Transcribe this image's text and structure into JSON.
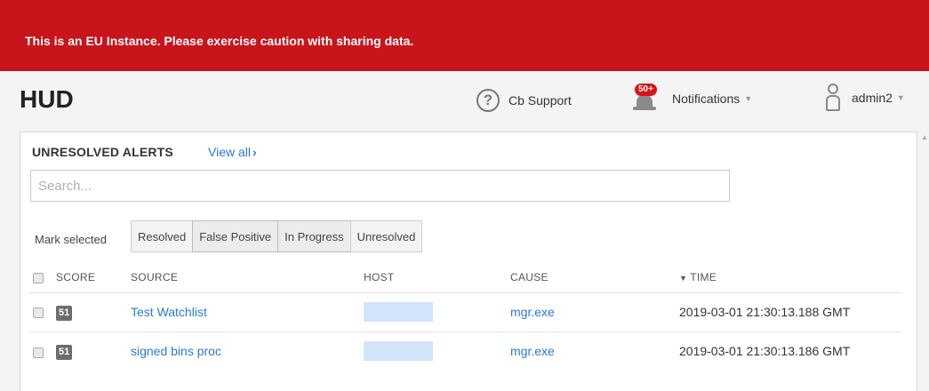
{
  "banner": {
    "text": "This is an EU Instance. Please exercise caution with sharing data."
  },
  "header": {
    "title": "HUD",
    "support_label": "Cb Support",
    "notifications_label": "Notifications",
    "notifications_badge": "50+",
    "user_label": "admin2"
  },
  "alerts": {
    "title": "UNRESOLVED ALERTS",
    "view_all": "View all",
    "search_placeholder": "Search...",
    "mark_selected_label": "Mark selected",
    "mark_buttons": [
      "Resolved",
      "False Positive",
      "In Progress",
      "Unresolved"
    ],
    "columns": {
      "score": "SCORE",
      "source": "SOURCE",
      "host": "HOST",
      "cause": "CAUSE",
      "time": "TIME"
    },
    "rows": [
      {
        "score": "51",
        "source": "Test Watchlist",
        "cause": "mgr.exe",
        "time": "2019-03-01 21:30:13.188 GMT"
      },
      {
        "score": "51",
        "source": "signed bins proc",
        "cause": "mgr.exe",
        "time": "2019-03-01 21:30:13.186 GMT"
      }
    ]
  },
  "colors": {
    "banner": "#c8141a",
    "link": "#2a7ad8",
    "badge": "#d81418"
  }
}
